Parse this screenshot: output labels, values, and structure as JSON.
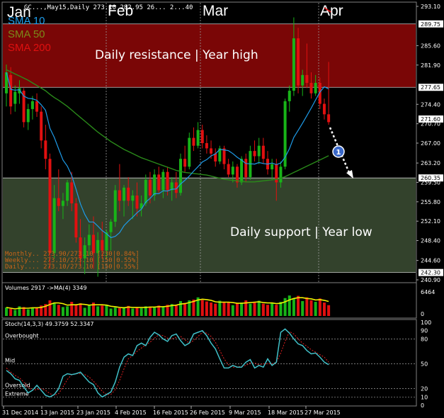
{
  "header": {
    "symbol_info": "GC...,May15,Daily  273.10 282.95 26... 2...40",
    "months": [
      "Jan",
      "Feb",
      "Mar",
      "Apr"
    ]
  },
  "indicators": [
    {
      "name": "SMA 10",
      "color": "#1e9be8"
    },
    {
      "name": "SMA 50",
      "color": "#7a8a1a"
    },
    {
      "name": "SMA 200",
      "color": "#e01010"
    }
  ],
  "zones": {
    "resistance_label": "Daily resistance | Year high",
    "support_label": "Daily support | Year low",
    "resistance_color": "#7a0606",
    "support_color": "#33422c"
  },
  "pivot_text": [
    "Monthly.. 273.90/273.10  [230|0.84%]",
    "Weekly... 273.10/273.10  [150|0.55%]",
    "Daily.... 273.10/273.10  [150|0.55%]"
  ],
  "marker_number": "1",
  "price_axis": {
    "labels": [
      "293.10",
      "289.75",
      "285.60",
      "281.90",
      "277.65",
      "274.40",
      "271.60",
      "270.70",
      "267.00",
      "263.20",
      "260.35",
      "259.50",
      "255.80",
      "252.10",
      "248.40",
      "244.60",
      "242.30",
      "240.90"
    ],
    "highlight_labels": [
      "289.75",
      "277.65",
      "271.60",
      "260.35",
      "242.30"
    ]
  },
  "volume_panel": {
    "title": "Volumes 2917  ->MA(4) 3349",
    "axis_labels": [
      "6464",
      "0"
    ]
  },
  "stoch_panel": {
    "title": "Stoch(14,3,3) 49.3759 52.3347",
    "levels": [
      {
        "name": "Overbought",
        "value": 80
      },
      {
        "name": "Mid",
        "value": 50
      },
      {
        "name": "Oversold",
        "value": 20
      },
      {
        "name": "Extreme",
        "value": 10
      }
    ],
    "axis_labels": [
      "100",
      "90",
      "80",
      "50",
      "20",
      "10",
      "0"
    ]
  },
  "date_axis": [
    "31 Dec 2014",
    "13 Jan 2015",
    "23 Jan 2015",
    "4 Feb 2015",
    "16 Feb 2015",
    "26 Feb 2015",
    "9 Mar 2015",
    "18 Mar 2015",
    "27 Mar 2015"
  ],
  "chart_data": {
    "type": "candlestick",
    "ylim": [
      240.9,
      293.1
    ],
    "resistance_zone": [
      277.65,
      289.75
    ],
    "support_zone": [
      242.3,
      260.35
    ],
    "candles": [
      {
        "o": 276.5,
        "h": 282.0,
        "l": 274.0,
        "c": 280.5
      },
      {
        "o": 280.0,
        "h": 281.5,
        "l": 272.5,
        "c": 274.0
      },
      {
        "o": 274.5,
        "h": 278.0,
        "l": 273.0,
        "c": 276.8
      },
      {
        "o": 276.5,
        "h": 279.0,
        "l": 274.5,
        "c": 277.5
      },
      {
        "o": 277.0,
        "h": 277.5,
        "l": 270.0,
        "c": 271.0
      },
      {
        "o": 271.0,
        "h": 274.5,
        "l": 269.5,
        "c": 273.5
      },
      {
        "o": 273.5,
        "h": 276.0,
        "l": 271.5,
        "c": 275.0
      },
      {
        "o": 275.0,
        "h": 276.5,
        "l": 272.0,
        "c": 273.0
      },
      {
        "o": 273.0,
        "h": 274.0,
        "l": 266.0,
        "c": 267.5
      },
      {
        "o": 267.5,
        "h": 270.5,
        "l": 262.0,
        "c": 264.0
      },
      {
        "o": 264.0,
        "h": 265.0,
        "l": 243.0,
        "c": 246.0
      },
      {
        "o": 246.0,
        "h": 259.0,
        "l": 245.0,
        "c": 256.5
      },
      {
        "o": 256.5,
        "h": 262.0,
        "l": 254.0,
        "c": 255.0
      },
      {
        "o": 255.0,
        "h": 257.5,
        "l": 252.5,
        "c": 256.0
      },
      {
        "o": 256.0,
        "h": 260.0,
        "l": 255.0,
        "c": 259.5
      },
      {
        "o": 259.5,
        "h": 261.5,
        "l": 254.0,
        "c": 255.5
      },
      {
        "o": 255.5,
        "h": 256.5,
        "l": 248.0,
        "c": 249.0
      },
      {
        "o": 249.0,
        "h": 252.5,
        "l": 243.5,
        "c": 245.0
      },
      {
        "o": 245.0,
        "h": 249.0,
        "l": 242.0,
        "c": 247.5
      },
      {
        "o": 247.5,
        "h": 251.5,
        "l": 245.5,
        "c": 249.5
      },
      {
        "o": 249.5,
        "h": 253.0,
        "l": 243.0,
        "c": 246.0
      },
      {
        "o": 246.0,
        "h": 250.0,
        "l": 241.5,
        "c": 248.5
      },
      {
        "o": 248.5,
        "h": 252.0,
        "l": 245.0,
        "c": 246.5
      },
      {
        "o": 246.5,
        "h": 250.5,
        "l": 245.0,
        "c": 250.0
      },
      {
        "o": 250.0,
        "h": 252.5,
        "l": 246.5,
        "c": 252.0
      },
      {
        "o": 252.0,
        "h": 259.0,
        "l": 251.0,
        "c": 258.0
      },
      {
        "o": 258.0,
        "h": 263.0,
        "l": 254.0,
        "c": 256.0
      },
      {
        "o": 256.0,
        "h": 259.0,
        "l": 253.0,
        "c": 258.5
      },
      {
        "o": 258.5,
        "h": 260.5,
        "l": 255.0,
        "c": 256.0
      },
      {
        "o": 256.0,
        "h": 258.0,
        "l": 252.5,
        "c": 257.0
      },
      {
        "o": 257.0,
        "h": 259.5,
        "l": 253.0,
        "c": 254.5
      },
      {
        "o": 254.5,
        "h": 257.0,
        "l": 253.0,
        "c": 255.5
      },
      {
        "o": 255.5,
        "h": 261.0,
        "l": 255.0,
        "c": 260.0
      },
      {
        "o": 260.0,
        "h": 261.5,
        "l": 255.5,
        "c": 257.0
      },
      {
        "o": 257.0,
        "h": 262.0,
        "l": 256.0,
        "c": 261.0
      },
      {
        "o": 261.0,
        "h": 262.5,
        "l": 257.5,
        "c": 258.0
      },
      {
        "o": 258.0,
        "h": 262.0,
        "l": 256.5,
        "c": 261.5
      },
      {
        "o": 261.5,
        "h": 262.5,
        "l": 257.0,
        "c": 258.0
      },
      {
        "o": 258.0,
        "h": 260.5,
        "l": 256.0,
        "c": 259.5
      },
      {
        "o": 259.5,
        "h": 261.5,
        "l": 256.5,
        "c": 257.5
      },
      {
        "o": 257.5,
        "h": 265.0,
        "l": 257.0,
        "c": 264.0
      },
      {
        "o": 264.0,
        "h": 266.5,
        "l": 261.5,
        "c": 262.5
      },
      {
        "o": 262.5,
        "h": 269.0,
        "l": 262.0,
        "c": 268.0
      },
      {
        "o": 268.0,
        "h": 270.0,
        "l": 265.5,
        "c": 266.5
      },
      {
        "o": 266.5,
        "h": 271.0,
        "l": 266.0,
        "c": 269.5
      },
      {
        "o": 269.5,
        "h": 270.5,
        "l": 266.0,
        "c": 267.0
      },
      {
        "o": 267.0,
        "h": 268.5,
        "l": 265.0,
        "c": 266.0
      },
      {
        "o": 266.0,
        "h": 267.5,
        "l": 264.0,
        "c": 265.0
      },
      {
        "o": 265.0,
        "h": 266.0,
        "l": 262.5,
        "c": 263.5
      },
      {
        "o": 263.5,
        "h": 266.5,
        "l": 263.0,
        "c": 266.0
      },
      {
        "o": 266.0,
        "h": 266.5,
        "l": 262.0,
        "c": 263.0
      },
      {
        "o": 263.0,
        "h": 264.0,
        "l": 260.5,
        "c": 261.0
      },
      {
        "o": 261.0,
        "h": 263.5,
        "l": 259.5,
        "c": 262.5
      },
      {
        "o": 262.5,
        "h": 263.0,
        "l": 258.5,
        "c": 259.5
      },
      {
        "o": 259.5,
        "h": 264.5,
        "l": 259.0,
        "c": 264.0
      },
      {
        "o": 264.0,
        "h": 265.0,
        "l": 259.5,
        "c": 260.5
      },
      {
        "o": 260.5,
        "h": 266.5,
        "l": 260.0,
        "c": 265.5
      },
      {
        "o": 265.5,
        "h": 267.5,
        "l": 263.5,
        "c": 264.5
      },
      {
        "o": 264.5,
        "h": 268.0,
        "l": 263.0,
        "c": 266.5
      },
      {
        "o": 266.5,
        "h": 268.0,
        "l": 263.0,
        "c": 264.0
      },
      {
        "o": 264.0,
        "h": 265.5,
        "l": 261.0,
        "c": 262.0
      },
      {
        "o": 262.0,
        "h": 264.0,
        "l": 260.0,
        "c": 263.0
      },
      {
        "o": 263.0,
        "h": 264.0,
        "l": 256.0,
        "c": 259.5
      },
      {
        "o": 259.5,
        "h": 263.5,
        "l": 258.5,
        "c": 262.5
      },
      {
        "o": 262.5,
        "h": 275.5,
        "l": 262.0,
        "c": 275.0
      },
      {
        "o": 275.0,
        "h": 278.0,
        "l": 273.0,
        "c": 277.0
      },
      {
        "o": 277.0,
        "h": 291.0,
        "l": 276.0,
        "c": 287.0
      },
      {
        "o": 287.0,
        "h": 289.0,
        "l": 276.5,
        "c": 278.0
      },
      {
        "o": 278.0,
        "h": 281.0,
        "l": 276.0,
        "c": 280.0
      },
      {
        "o": 280.0,
        "h": 286.0,
        "l": 277.5,
        "c": 278.5
      },
      {
        "o": 278.5,
        "h": 280.5,
        "l": 275.5,
        "c": 276.5
      },
      {
        "o": 276.5,
        "h": 280.0,
        "l": 276.0,
        "c": 278.5
      },
      {
        "o": 278.5,
        "h": 279.5,
        "l": 273.5,
        "c": 274.5
      },
      {
        "o": 274.5,
        "h": 275.5,
        "l": 271.5,
        "c": 272.5
      },
      {
        "o": 272.5,
        "h": 282.5,
        "l": 270.5,
        "c": 271.0
      }
    ],
    "volume": [
      2.3,
      1.9,
      1.6,
      2.6,
      2.4,
      1.8,
      2.2,
      2.3,
      2.8,
      3.2,
      4.2,
      3.6,
      3.0,
      2.4,
      2.6,
      3.8,
      3.1,
      3.4,
      2.2,
      3.0,
      3.6,
      2.6,
      2.8,
      3.0,
      2.0,
      2.3,
      2.1,
      2.4,
      2.7,
      2.0,
      2.3,
      2.1,
      2.6,
      2.5,
      2.3,
      2.8,
      2.4,
      3.0,
      3.2,
      2.8,
      4.0,
      3.5,
      4.2,
      4.4,
      5.0,
      4.3,
      3.9,
      3.6,
      3.3,
      4.1,
      3.6,
      3.8,
      2.9,
      3.4,
      3.6,
      4.2,
      3.3,
      3.6,
      4.1,
      3.3,
      3.0,
      3.6,
      3.0,
      3.8,
      4.8,
      5.5,
      4.6,
      5.4,
      4.0,
      5.0,
      4.2,
      3.8,
      4.7,
      3.6,
      2.9
    ],
    "volume_ma": [
      2.3,
      2.1,
      1.9,
      2.1,
      2.1,
      2.1,
      2.2,
      2.2,
      2.3,
      2.6,
      3.1,
      3.5,
      3.5,
      3.3,
      2.9,
      3.0,
      3.0,
      3.2,
      3.1,
      2.9,
      3.0,
      3.0,
      3.0,
      2.9,
      2.6,
      2.5,
      2.3,
      2.2,
      2.4,
      2.3,
      2.3,
      2.3,
      2.3,
      2.4,
      2.4,
      2.5,
      2.5,
      2.6,
      2.8,
      2.9,
      3.2,
      3.3,
      3.6,
      3.9,
      4.3,
      4.5,
      4.4,
      4.2,
      3.8,
      3.7,
      3.7,
      3.7,
      3.6,
      3.4,
      3.4,
      3.5,
      3.6,
      3.7,
      3.8,
      3.6,
      3.5,
      3.5,
      3.3,
      3.4,
      3.8,
      4.3,
      4.7,
      4.9,
      4.9,
      4.7,
      4.6,
      4.3,
      4.4,
      4.2,
      3.9
    ],
    "volume_ylim": [
      0,
      6.464
    ],
    "stoch_k": [
      42,
      38,
      32,
      30,
      22,
      15,
      18,
      24,
      18,
      12,
      10,
      13,
      20,
      35,
      38,
      37,
      38,
      40,
      34,
      28,
      25,
      15,
      10,
      13,
      16,
      28,
      46,
      58,
      62,
      60,
      72,
      75,
      72,
      82,
      88,
      85,
      80,
      77,
      84,
      86,
      78,
      72,
      75,
      86,
      88,
      90,
      84,
      75,
      68,
      56,
      45,
      45,
      48,
      46,
      46,
      52,
      55,
      45,
      48,
      46,
      56,
      48,
      52,
      88,
      92,
      87,
      80,
      74,
      72,
      66,
      62,
      63,
      58,
      52,
      49
    ],
    "stoch_d": [
      45,
      40,
      36,
      33,
      28,
      22,
      18,
      19,
      20,
      18,
      14,
      12,
      14,
      22,
      31,
      37,
      38,
      38,
      37,
      34,
      29,
      23,
      17,
      13,
      13,
      19,
      30,
      44,
      56,
      60,
      65,
      69,
      73,
      76,
      81,
      85,
      84,
      81,
      80,
      82,
      83,
      79,
      75,
      78,
      83,
      88,
      87,
      83,
      76,
      66,
      56,
      49,
      46,
      46,
      47,
      48,
      51,
      51,
      49,
      50,
      50,
      50,
      52,
      63,
      77,
      89,
      86,
      80,
      75,
      71,
      67,
      64,
      61,
      58,
      52
    ],
    "sma200_segment": [
      {
        "x": 73.0,
        "y": 293.1
      },
      {
        "x": 74.5,
        "y": 292.3
      }
    ]
  }
}
